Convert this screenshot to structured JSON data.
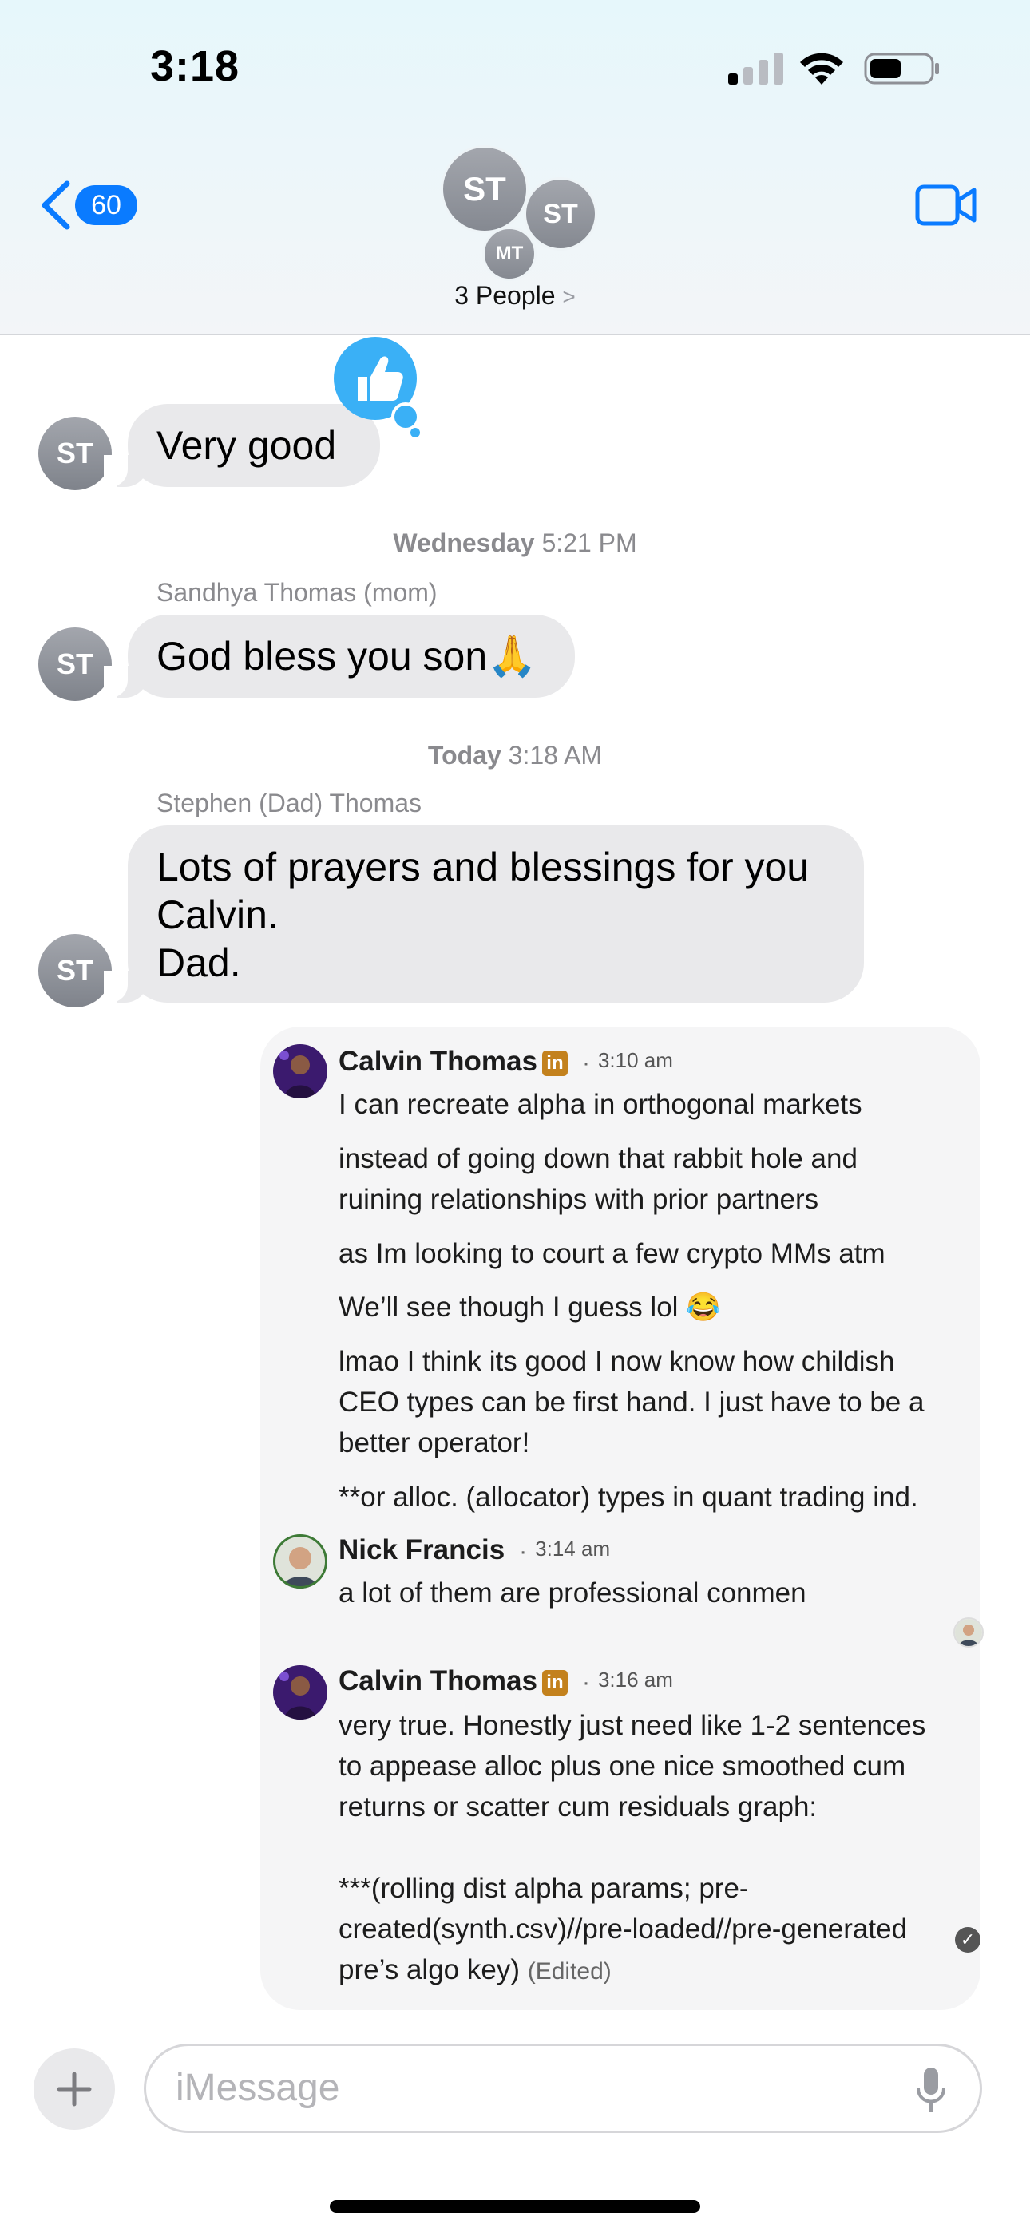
{
  "status_bar": {
    "time": "3:18"
  },
  "header": {
    "back_count": "60",
    "avatars": [
      "ST",
      "ST",
      "MT"
    ],
    "people_label": "3 People",
    "chevron": ">"
  },
  "messages": [
    {
      "avatar": "ST",
      "text": "Very good",
      "tapback": "thumbs-up-icon"
    },
    {
      "timestamp_day": "Wednesday",
      "timestamp_time": "5:21 PM",
      "sender": "Sandhya  Thomas (mom)",
      "avatar": "ST",
      "text": "God bless you son🙏"
    },
    {
      "timestamp_day": "Today",
      "timestamp_time": "3:18 AM",
      "sender": "Stephen (Dad) Thomas",
      "avatar": "ST",
      "text": "Lots of prayers and blessings for you\nCalvin.\nDad."
    }
  ],
  "linkedin_card": {
    "linkedin_badge": "in",
    "dot": "·",
    "posts": [
      {
        "name": "Calvin Thomas",
        "time": "3:10 am",
        "lines": [
          "I can recreate alpha in orthogonal markets",
          "instead of going down that rabbit hole and\nruining relationships with prior partners",
          "as Im looking to court a few crypto MMs atm",
          "We’ll see though I guess lol 😂",
          "lmao I think its good I now know how childish\nCEO types can be first hand. I just have to be a\nbetter operator!",
          "**or alloc. (allocator) types in quant trading ind."
        ]
      },
      {
        "name": "Nick Francis",
        "time": "3:14 am",
        "lines": [
          "a lot of them are professional conmen"
        ]
      },
      {
        "name": "Calvin Thomas",
        "time": "3:16 am",
        "lines": [
          "very true. Honestly just need like 1-2 sentences\nto appease alloc plus one nice smoothed cum\nreturns or scatter cum residuals graph:\n\n***(rolling dist alpha params; pre-\ncreated(synth.csv)//pre-loaded//pre-generated\npre’s algo key)"
        ],
        "edited": "(Edited)"
      }
    ]
  },
  "input": {
    "placeholder": "iMessage"
  },
  "colors": {
    "accent": "#0a7bff",
    "bubble_gray": "#e9e9eb",
    "tapback": "#3ab0f6",
    "linkedin": "#c3811d"
  }
}
